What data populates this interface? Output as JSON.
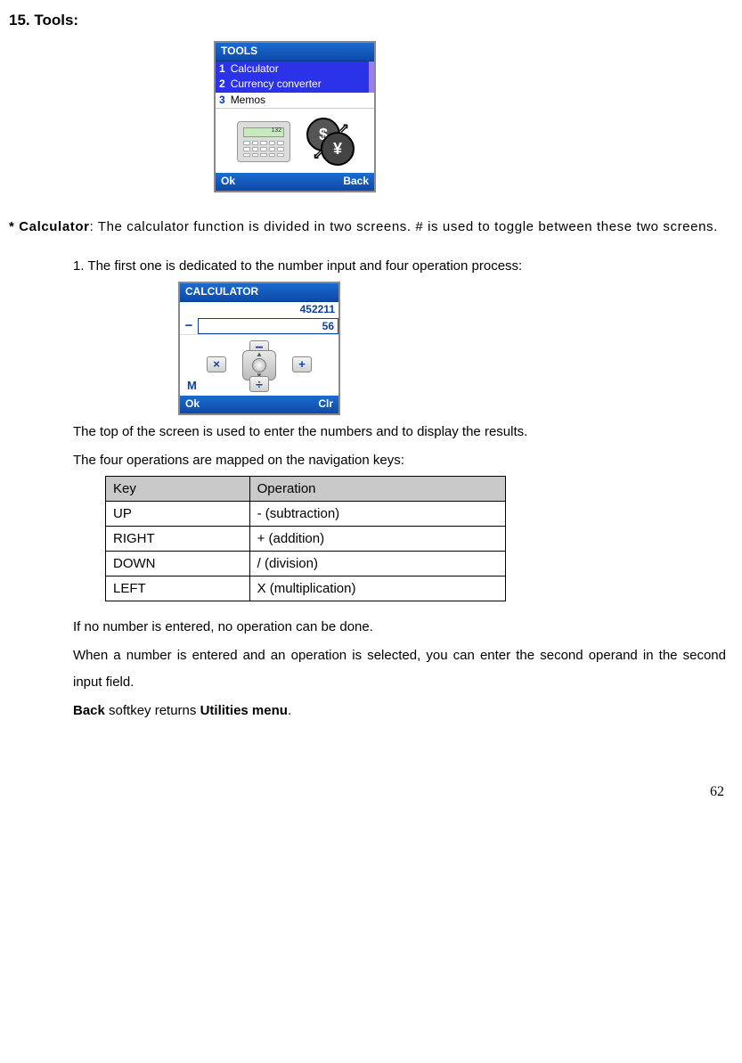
{
  "heading": "15. Tools:",
  "toolsScreen": {
    "title": "TOOLS",
    "items": [
      {
        "num": "1",
        "label": "Calculator"
      },
      {
        "num": "2",
        "label": "Currency converter"
      },
      {
        "num": "3",
        "label": "Memos"
      }
    ],
    "softkeys": {
      "left": "Ok",
      "right": "Back"
    },
    "calcDisplay": "132",
    "coin1": "$",
    "coin2": "¥"
  },
  "para1": {
    "lead": "* Calculator",
    "rest": ": The calculator function is divided in two screens. # is used to toggle between these two screens."
  },
  "step1": "1. The first one is dedicated to the number input and four operation process:",
  "calcScreen": {
    "title": "CALCULATOR",
    "line1": "452211",
    "operator": "−",
    "line2": "56",
    "keys": {
      "mul": "×",
      "plus": "+",
      "minusGlyph": "−",
      "divGlyph": "÷"
    },
    "mLabel": "M",
    "softkeys": {
      "left": "Ok",
      "right": "Clr"
    }
  },
  "afterCalc1": "The top of the screen is used to enter the numbers and to display the results.",
  "afterCalc2": "The four operations are mapped on the navigation keys:",
  "table": {
    "headers": [
      "Key",
      "Operation"
    ],
    "rows": [
      [
        "UP",
        "- (subtraction)"
      ],
      [
        "RIGHT",
        "+ (addition)"
      ],
      [
        "DOWN",
        "/ (division)"
      ],
      [
        "LEFT",
        "X (multiplication)"
      ]
    ]
  },
  "afterTable1": "If no number is entered, no operation can be done.",
  "afterTable2": "When a number is entered and an operation is selected, you can enter the second operand in the second input field.",
  "afterTable3a": "Back",
  "afterTable3b": " softkey returns ",
  "afterTable3c": "Utilities menu",
  "afterTable3d": ".",
  "pageNumber": "62"
}
